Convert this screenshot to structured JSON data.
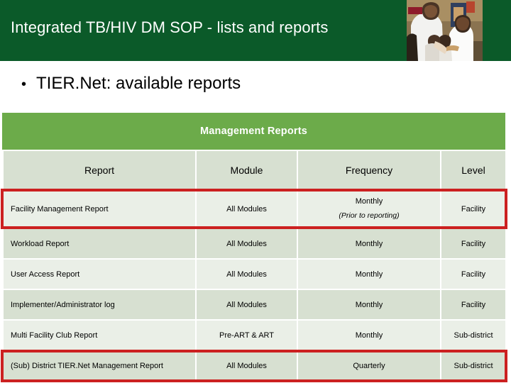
{
  "slide": {
    "title": "Integrated TB/HIV DM SOP - lists and reports",
    "header_color": "#0b5a29",
    "accent_color": "#6cab4a",
    "highlight_color": "#cc2020",
    "photo_alt": "health-worker-and-children-photo"
  },
  "bullets": [
    {
      "marker": "•",
      "text": "TIER.Net: available reports"
    }
  ],
  "table": {
    "band_label": "Management Reports",
    "columns": [
      "Report",
      "Module",
      "Frequency",
      "Level"
    ],
    "rows": [
      {
        "report": "Facility Management Report",
        "module": "All Modules",
        "frequency": "Monthly",
        "frequency_note": "(Prior to reporting)",
        "level": "Facility",
        "highlighted": true
      },
      {
        "report": "Workload Report",
        "module": "All Modules",
        "frequency": "Monthly",
        "frequency_note": "",
        "level": "Facility",
        "highlighted": false
      },
      {
        "report": "User Access Report",
        "module": "All Modules",
        "frequency": "Monthly",
        "frequency_note": "",
        "level": "Facility",
        "highlighted": false
      },
      {
        "report": "Implementer/Administrator log",
        "module": "All Modules",
        "frequency": "Monthly",
        "frequency_note": "",
        "level": "Facility",
        "highlighted": false
      },
      {
        "report": "Multi Facility Club Report",
        "module": "Pre-ART & ART",
        "frequency": "Monthly",
        "frequency_note": "",
        "level": "Sub-district",
        "highlighted": false
      },
      {
        "report": "(Sub) District TIER.Net Management Report",
        "module": "All Modules",
        "frequency": "Quarterly",
        "frequency_note": "",
        "level": "Sub-district",
        "highlighted": true
      }
    ]
  }
}
